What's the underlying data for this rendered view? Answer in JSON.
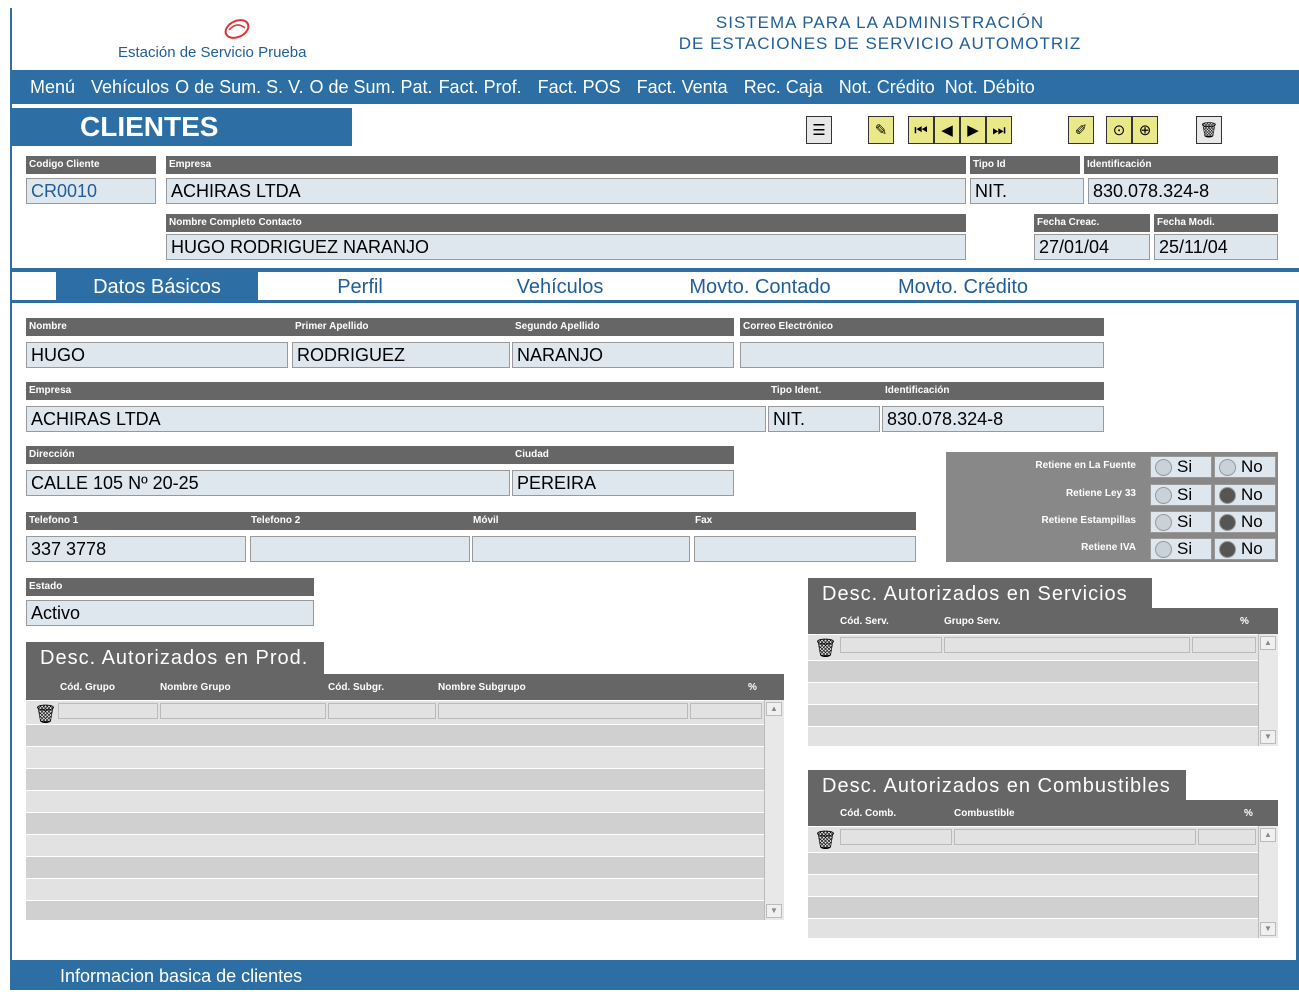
{
  "header": {
    "company_name": "Estación de Servicio Prueba",
    "system_title_line1": "SISTEMA PARA LA ADMINISTRACIÓN",
    "system_title_line2": "DE ESTACIONES DE SERVICIO AUTOMOTRIZ"
  },
  "menu": [
    "Menú",
    "Vehículos",
    "O de Sum. S. V.",
    "O de Sum. Pat.",
    "Fact. Prof.",
    "Fact. POS",
    "Fact. Venta",
    "Rec. Caja",
    "Not. Crédito",
    "Not. Débito"
  ],
  "page_title": "CLIENTES",
  "toolbar": {
    "list": "☰",
    "new": "✎",
    "first": "⏮",
    "prev": "◀",
    "next": "▶",
    "last": "⏭",
    "edit": "✐",
    "search1": "⊙",
    "search2": "⊕",
    "delete": "🗑"
  },
  "header_fields": {
    "codigo_label": "Codigo Cliente",
    "codigo_value": "CR0010",
    "empresa_label": "Empresa",
    "empresa_value": "ACHIRAS LTDA",
    "tipo_id_label": "Tipo Id",
    "tipo_id_value": "NIT.",
    "identificacion_label": "Identificación",
    "identificacion_value": "830.078.324-8",
    "contacto_label": "Nombre Completo Contacto",
    "contacto_value": "HUGO RODRIGUEZ NARANJO",
    "fecha_crea_label": "Fecha Creac.",
    "fecha_crea_value": "27/01/04",
    "fecha_modi_label": "Fecha Modi.",
    "fecha_modi_value": "25/11/04"
  },
  "tabs": [
    "Datos Básicos",
    "Perfil",
    "Vehículos",
    "Movto. Contado",
    "Movto. Crédito"
  ],
  "basic": {
    "nombre_label": "Nombre",
    "nombre_value": "HUGO",
    "apellido1_label": "Primer Apellido",
    "apellido1_value": "RODRIGUEZ",
    "apellido2_label": "Segundo Apellido",
    "apellido2_value": "NARANJO",
    "correo_label": "Correo Electrónico",
    "correo_value": "",
    "empresa_label": "Empresa",
    "empresa_value": "ACHIRAS LTDA",
    "tipo_ident_label": "Tipo Ident.",
    "tipo_ident_value": "NIT.",
    "ident_label": "Identificación",
    "ident_value": "830.078.324-8",
    "direccion_label": "Dirección",
    "direccion_value": "CALLE 105 Nº 20-25",
    "ciudad_label": "Ciudad",
    "ciudad_value": "PEREIRA",
    "tel1_label": "Telefono 1",
    "tel1_value": "337 3778",
    "tel2_label": "Telefono 2",
    "tel2_value": "",
    "movil_label": "Móvil",
    "movil_value": "",
    "fax_label": "Fax",
    "fax_value": "",
    "estado_label": "Estado",
    "estado_value": "Activo"
  },
  "retentions": [
    {
      "label": "Retiene en La Fuente",
      "si": "Si",
      "no": "No",
      "selected": "none"
    },
    {
      "label": "Retiene Ley 33",
      "si": "Si",
      "no": "No",
      "selected": "no"
    },
    {
      "label": "Retiene Estampillas",
      "si": "Si",
      "no": "No",
      "selected": "no"
    },
    {
      "label": "Retiene IVA",
      "si": "Si",
      "no": "No",
      "selected": "no"
    }
  ],
  "desc_prod": {
    "title": "Desc. Autorizados en Prod.",
    "columns": [
      "Cód. Grupo",
      "Nombre Grupo",
      "Cód. Subgr.",
      "Nombre Subgrupo",
      "%"
    ]
  },
  "desc_serv": {
    "title": "Desc. Autorizados en Servicios",
    "columns": [
      "Cód. Serv.",
      "Grupo Serv.",
      "%"
    ]
  },
  "desc_comb": {
    "title": "Desc. Autorizados en Combustibles",
    "columns": [
      "Cód. Comb.",
      "Combustible",
      "%"
    ]
  },
  "status_text": "Informacion basica de clientes"
}
